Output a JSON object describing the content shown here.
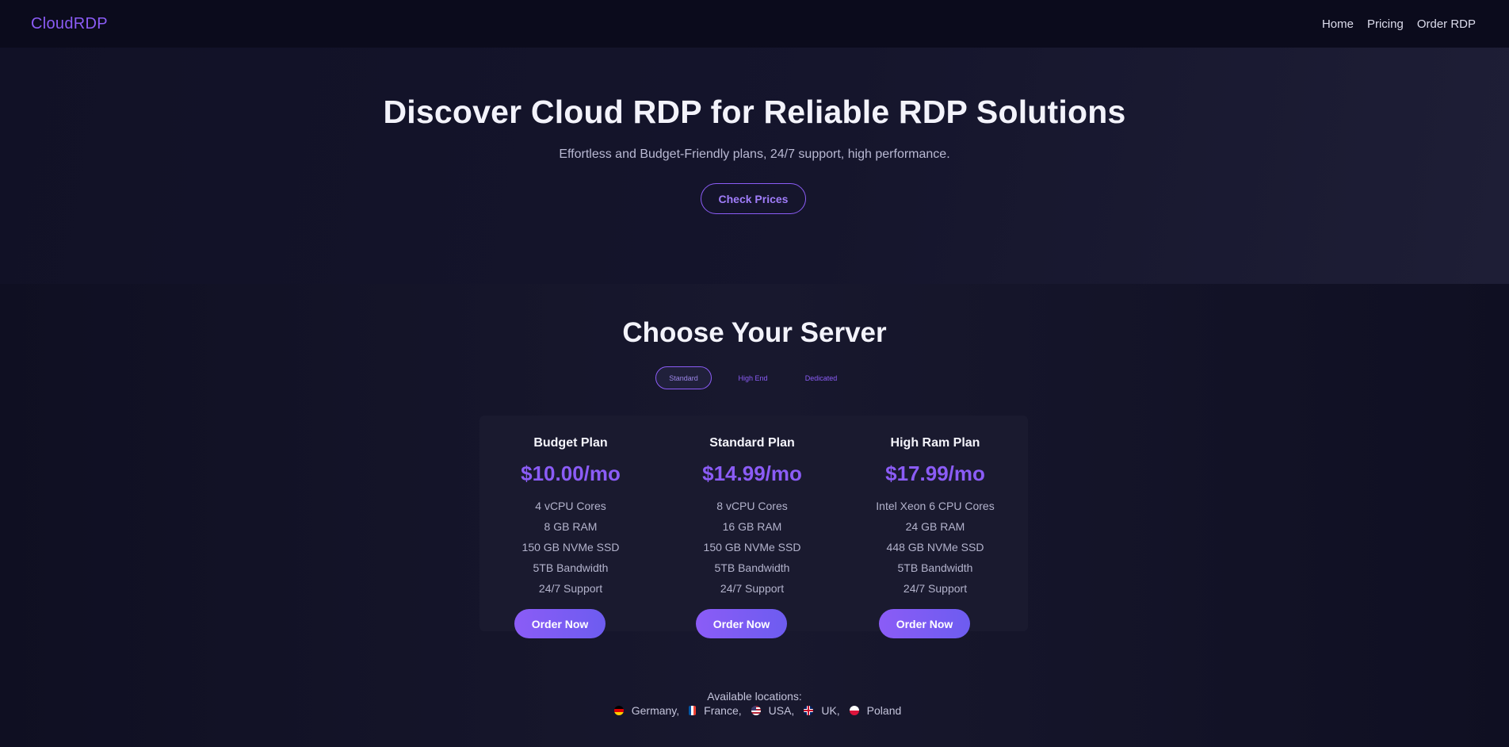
{
  "brand": "CloudRDP",
  "nav": {
    "links": [
      "Home",
      "Pricing",
      "Order RDP"
    ]
  },
  "hero": {
    "title": "Discover Cloud RDP for Reliable RDP Solutions",
    "subtitle": "Effortless and Budget-Friendly plans, 24/7 support, high performance.",
    "cta": "Check Prices"
  },
  "pricing": {
    "title": "Choose Your Server",
    "tabs": [
      {
        "label": "Standard",
        "active": true
      },
      {
        "label": "High End",
        "active": false
      },
      {
        "label": "Dedicated",
        "active": false
      }
    ],
    "plans": [
      {
        "name": "Budget Plan",
        "price": "$10.00/mo",
        "features": [
          "4 vCPU Cores",
          "8 GB RAM",
          "150 GB NVMe SSD",
          "5TB Bandwidth",
          "24/7 Support"
        ],
        "button": "Order Now"
      },
      {
        "name": "Standard Plan",
        "price": "$14.99/mo",
        "features": [
          "8 vCPU Cores",
          "16 GB RAM",
          "150 GB NVMe SSD",
          "5TB Bandwidth",
          "24/7 Support"
        ],
        "button": "Order Now"
      },
      {
        "name": "High Ram Plan",
        "price": "$17.99/mo",
        "features": [
          "Intel Xeon 6 CPU Cores",
          "24 GB RAM",
          "448 GB NVMe SSD",
          "5TB Bandwidth",
          "24/7 Support"
        ],
        "button": "Order Now"
      }
    ]
  },
  "locations": {
    "label": "Available locations:",
    "items": [
      {
        "name": "Germany,",
        "flag": "germany-flag-icon"
      },
      {
        "name": "France,",
        "flag": "france-flag-icon"
      },
      {
        "name": "USA,",
        "flag": "usa-flag-icon"
      },
      {
        "name": "UK,",
        "flag": "uk-flag-icon"
      },
      {
        "name": "Poland",
        "flag": "poland-flag-icon"
      }
    ]
  },
  "colors": {
    "accent": "#8b5cf6",
    "background": "#111124",
    "nav_background": "#0b0b1c",
    "card_background": "#1a1a2f"
  }
}
